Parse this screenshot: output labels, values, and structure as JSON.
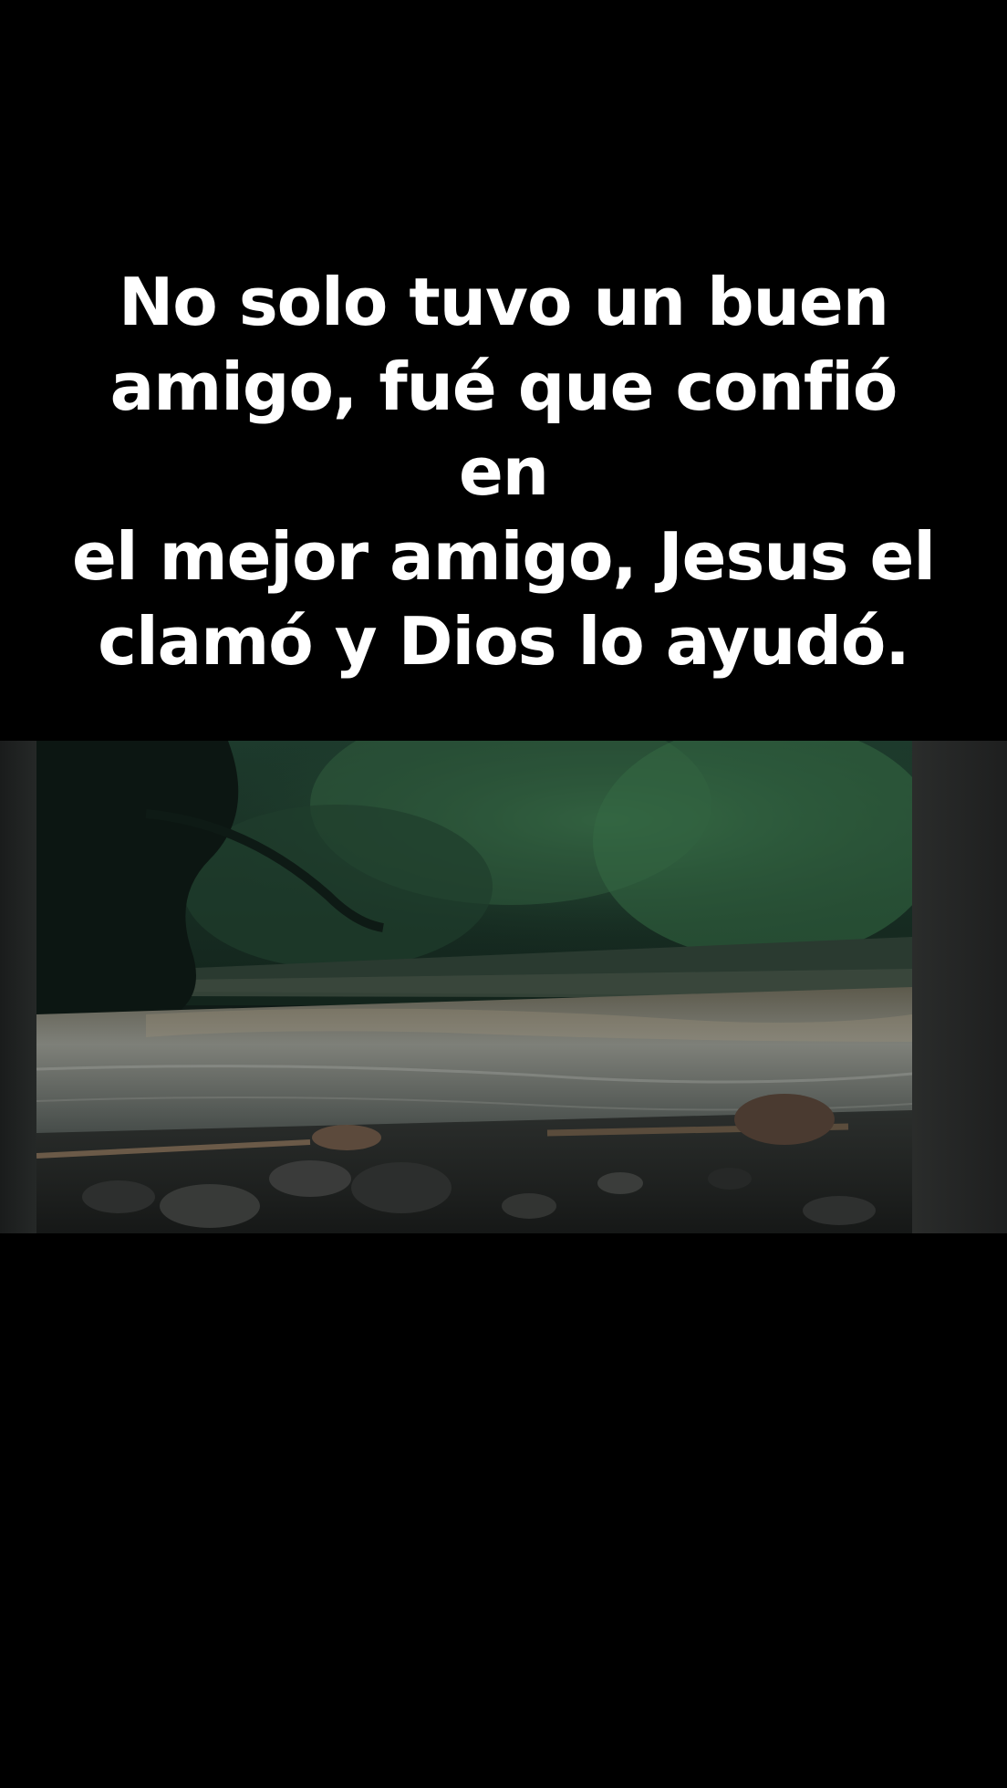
{
  "caption": {
    "lines": [
      "No solo tuvo un buen",
      "amigo, fué que confió en",
      "el mejor amigo, Jesus el",
      "clamó y Dios lo ayudó."
    ],
    "color": "#ffffff"
  },
  "video": {
    "scene_icon": "river-forest-scene-image"
  },
  "colors": {
    "background": "#000000",
    "band": "#141414"
  }
}
